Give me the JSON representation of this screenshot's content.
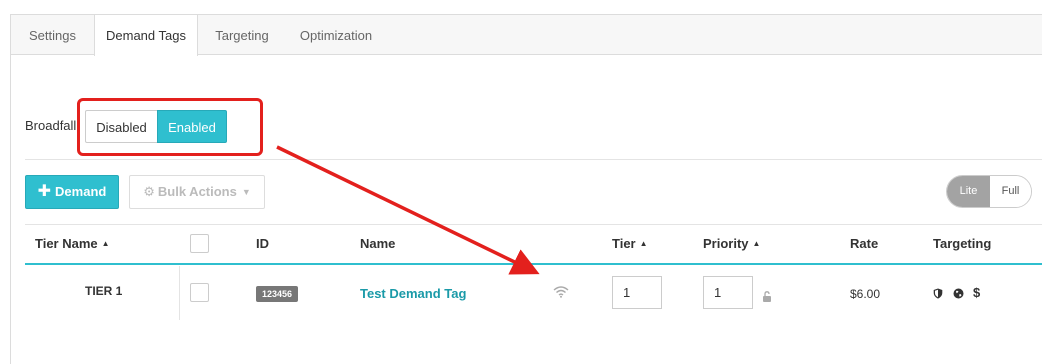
{
  "tabs": [
    {
      "label": "Settings"
    },
    {
      "label": "Demand Tags",
      "active": true
    },
    {
      "label": "Targeting"
    },
    {
      "label": "Optimization"
    }
  ],
  "broadfall": {
    "label": "Broadfall",
    "disabled_label": "Disabled",
    "enabled_label": "Enabled",
    "selected": "Enabled"
  },
  "toolbar": {
    "demand_label": "Demand",
    "bulk_actions_label": "Bulk Actions",
    "view_lite_label": "Lite",
    "view_full_label": "Full",
    "view_selected": "Lite"
  },
  "table": {
    "headers": {
      "tier_name": "Tier Name",
      "id": "ID",
      "name": "Name",
      "tier": "Tier",
      "priority": "Priority",
      "rate": "Rate",
      "targeting": "Targeting"
    },
    "rows": [
      {
        "tier_name": "TIER 1",
        "id": "123456",
        "name": "Test Demand Tag",
        "tier": "1",
        "priority": "1",
        "rate": "$6.00",
        "targeting_icons": [
          "shield-icon",
          "globe-icon",
          "dollar-icon"
        ],
        "targeting_dollar": "$"
      }
    ]
  },
  "colors": {
    "accent": "#2fbfcf",
    "annotation": "#e3201d",
    "link": "#1a9aa8"
  }
}
